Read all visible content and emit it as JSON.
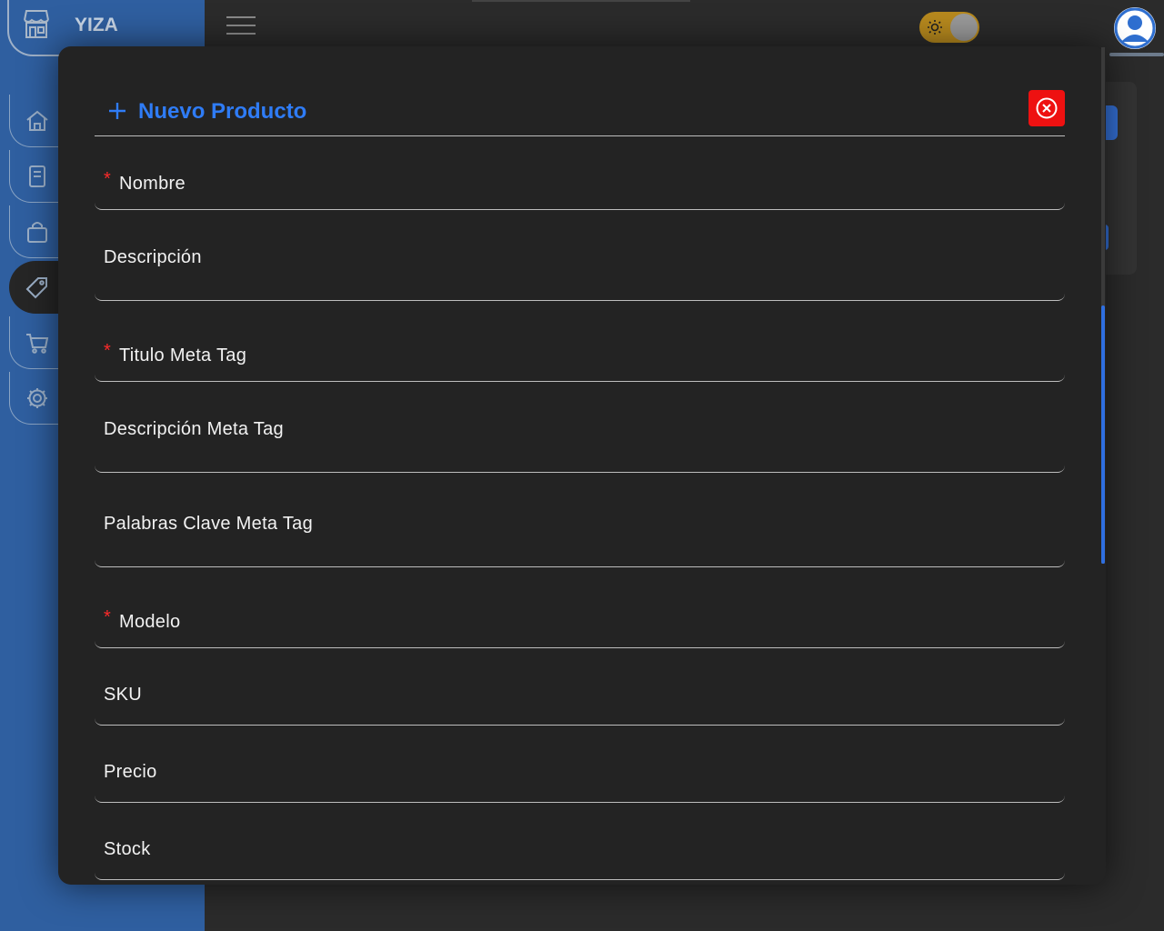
{
  "brand": {
    "name": "YIZA"
  },
  "sidebar": {
    "items": [
      {
        "icon": "home-icon"
      },
      {
        "icon": "document-icon"
      },
      {
        "icon": "bag-icon"
      },
      {
        "icon": "tag-icon",
        "active": true
      },
      {
        "icon": "cart-icon"
      },
      {
        "icon": "gear-icon"
      }
    ]
  },
  "header": {
    "theme_toggle": {
      "icon": "sun-icon",
      "state": "dark"
    },
    "avatar_icon": "user-avatar-icon"
  },
  "modal": {
    "title": "Nuevo Producto",
    "fields": [
      {
        "label": "Nombre",
        "required": true
      },
      {
        "label": "Descripción",
        "required": false
      },
      {
        "label": "Titulo Meta Tag",
        "required": true
      },
      {
        "label": "Descripción Meta Tag",
        "required": false
      },
      {
        "label": "Palabras Clave Meta Tag",
        "required": false
      },
      {
        "label": "Modelo",
        "required": true
      },
      {
        "label": "SKU",
        "required": false
      },
      {
        "label": "Precio",
        "required": false
      },
      {
        "label": "Stock",
        "required": false
      }
    ],
    "required_marker": "*"
  },
  "colors": {
    "accent": "#2f7cf6",
    "sidebar": "#2f5fa0",
    "danger": "#ee1111",
    "toggle": "#b88a1e"
  }
}
